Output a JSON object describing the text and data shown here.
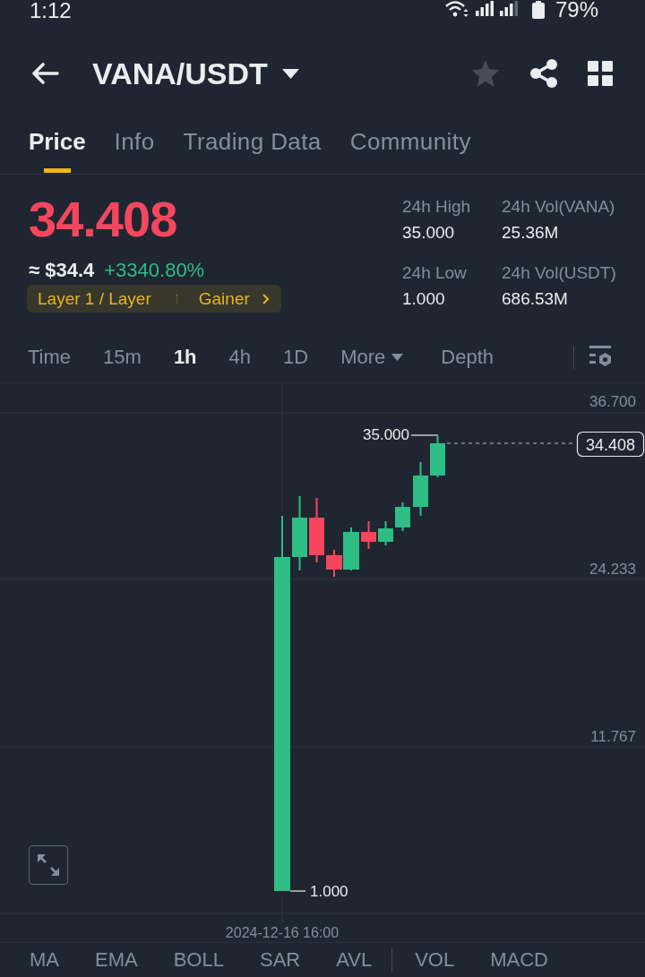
{
  "status_bar": {
    "time": "1:12",
    "battery": "79%"
  },
  "header": {
    "pair": "VANA/USDT",
    "favorite": false
  },
  "tabs": [
    {
      "label": "Price",
      "selected": true
    },
    {
      "label": "Info",
      "selected": false
    },
    {
      "label": "Trading Data",
      "selected": false
    },
    {
      "label": "Community",
      "selected": false
    }
  ],
  "price": {
    "last": "34.408",
    "fiat": "≈ $34.4",
    "change": "+3340.80%",
    "tags": [
      "Layer 1 / Layer",
      "Gainer"
    ]
  },
  "stats": [
    {
      "label": "24h High",
      "value": "35.000"
    },
    {
      "label": "24h Vol(VANA)",
      "value": "25.36M"
    },
    {
      "label": "24h Low",
      "value": "1.000"
    },
    {
      "label": "24h Vol(USDT)",
      "value": "686.53M"
    }
  ],
  "intervals": [
    {
      "label": "Time",
      "kind": "option",
      "selected": false
    },
    {
      "label": "15m",
      "kind": "option",
      "selected": false
    },
    {
      "label": "1h",
      "kind": "option",
      "selected": true
    },
    {
      "label": "4h",
      "kind": "option",
      "selected": false
    },
    {
      "label": "1D",
      "kind": "option",
      "selected": false
    },
    {
      "label": "More",
      "kind": "menu",
      "selected": false
    },
    {
      "label": "Depth",
      "kind": "option",
      "selected": false
    }
  ],
  "chart": {
    "price_ticks": [
      "36.700",
      "24.233",
      "11.767"
    ],
    "last_price": "34.408",
    "high_label": "35.000",
    "low_label": "1.000",
    "time_label": "2024-12-16 16:00"
  },
  "indicators": {
    "main": [
      "MA",
      "EMA",
      "BOLL",
      "SAR",
      "AVL"
    ],
    "sub": [
      "VOL",
      "MACD"
    ]
  }
}
